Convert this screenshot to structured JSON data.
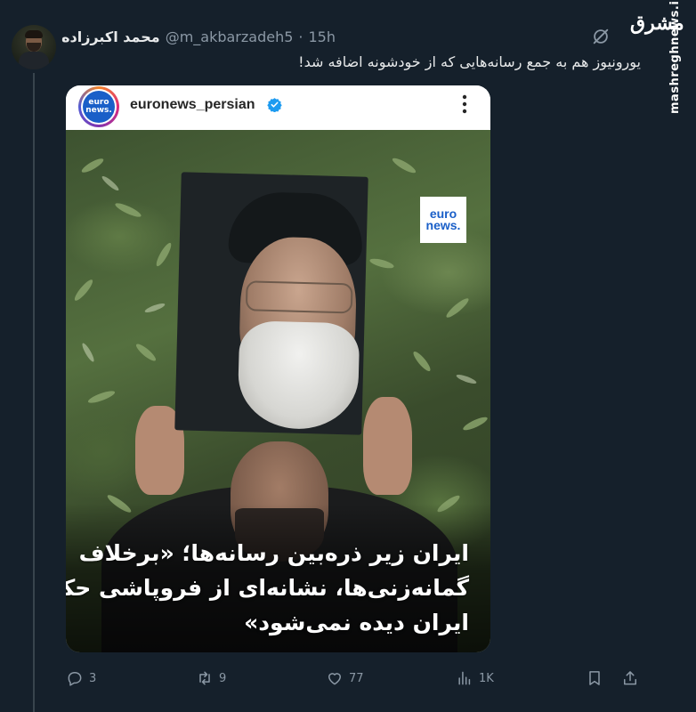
{
  "tweet": {
    "display_name": "محمد اکبرزاده",
    "handle": "@m_akbarzadeh5",
    "separator": "·",
    "time": "15h",
    "text": "یورونیوز هم به جمع رسانه‌هایی که از خودشونه اضافه شد!"
  },
  "watermark": {
    "logo_text": "مشرق",
    "site": "mashreghnews.ir"
  },
  "embedded_post": {
    "username": "euronews_persian",
    "avatar_text_top": "euro",
    "avatar_text_bottom": "news.",
    "logo_text_top": "euro",
    "logo_text_bottom": "news.",
    "caption_lines": [
      "ایران زیر ذره‌بین رسانه‌ها؛ «برخلاف",
      "گمانه‌زنی‌ها، نشانه‌ای از فروپاشی حکومت",
      "ایران دیده نمی‌شود»"
    ]
  },
  "actions": {
    "replies": "3",
    "reposts": "9",
    "likes": "77",
    "views": "1K"
  },
  "colors": {
    "background": "#15202b",
    "muted": "#8b98a5",
    "verified": "#1d9bf0",
    "euronews_blue": "#1a5fc8"
  }
}
